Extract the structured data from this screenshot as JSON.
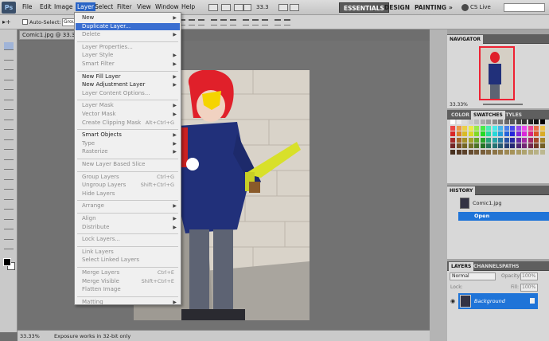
{
  "app": {
    "logo": "Ps"
  },
  "menubar": [
    "File",
    "Edit",
    "Image",
    "Layer",
    "Select",
    "Filter",
    "View",
    "Window",
    "Help"
  ],
  "active_menu": "Layer",
  "zoom_value": "33.3",
  "workspaces": [
    "ESSENTIALS",
    "DESIGN",
    "PAINTING"
  ],
  "more_symbol": "»",
  "cs_live": "CS Live",
  "options_bar": {
    "auto_select_label": "Auto-Select:",
    "auto_select_value": "Grou"
  },
  "document_tab": "Comic1.jpg @ 33.3% (R",
  "status": {
    "zoom": "33.33%",
    "message": "Exposure works in 32-bit only"
  },
  "layer_menu": [
    {
      "label": "New",
      "state": "normal",
      "arrow": true
    },
    {
      "label": "Duplicate Layer...",
      "state": "highlight"
    },
    {
      "label": "Delete",
      "state": "disabled",
      "arrow": true
    },
    {
      "sep": true
    },
    {
      "label": "Layer Properties...",
      "state": "disabled"
    },
    {
      "label": "Layer Style",
      "state": "disabled",
      "arrow": true
    },
    {
      "label": "Smart Filter",
      "state": "disabled",
      "arrow": true
    },
    {
      "sep": true
    },
    {
      "label": "New Fill Layer",
      "state": "normal",
      "arrow": true
    },
    {
      "label": "New Adjustment Layer",
      "state": "normal",
      "arrow": true
    },
    {
      "label": "Layer Content Options...",
      "state": "disabled"
    },
    {
      "sep": true
    },
    {
      "label": "Layer Mask",
      "state": "disabled",
      "arrow": true
    },
    {
      "label": "Vector Mask",
      "state": "disabled",
      "arrow": true
    },
    {
      "label": "Create Clipping Mask",
      "state": "disabled",
      "shortcut": "Alt+Ctrl+G"
    },
    {
      "sep": true
    },
    {
      "label": "Smart Objects",
      "state": "normal",
      "arrow": true
    },
    {
      "label": "Type",
      "state": "disabled",
      "arrow": true
    },
    {
      "label": "Rasterize",
      "state": "disabled",
      "arrow": true
    },
    {
      "sep": true
    },
    {
      "label": "New Layer Based Slice",
      "state": "disabled"
    },
    {
      "sep": true
    },
    {
      "label": "Group Layers",
      "state": "disabled",
      "shortcut": "Ctrl+G"
    },
    {
      "label": "Ungroup Layers",
      "state": "disabled",
      "shortcut": "Shift+Ctrl+G"
    },
    {
      "label": "Hide Layers",
      "state": "disabled"
    },
    {
      "sep": true
    },
    {
      "label": "Arrange",
      "state": "disabled",
      "arrow": true
    },
    {
      "sep": true
    },
    {
      "label": "Align",
      "state": "disabled",
      "arrow": true
    },
    {
      "label": "Distribute",
      "state": "disabled",
      "arrow": true
    },
    {
      "sep": true
    },
    {
      "label": "Lock Layers...",
      "state": "disabled"
    },
    {
      "sep": true
    },
    {
      "label": "Link Layers",
      "state": "disabled"
    },
    {
      "label": "Select Linked Layers",
      "state": "disabled"
    },
    {
      "sep": true
    },
    {
      "label": "Merge Layers",
      "state": "disabled",
      "shortcut": "Ctrl+E"
    },
    {
      "label": "Merge Visible",
      "state": "disabled",
      "shortcut": "Shift+Ctrl+E"
    },
    {
      "label": "Flatten Image",
      "state": "disabled"
    },
    {
      "sep": true
    },
    {
      "label": "Matting",
      "state": "disabled",
      "arrow": true
    }
  ],
  "navigator": {
    "title": "NAVIGATOR",
    "zoom": "33.33%"
  },
  "color_panel": {
    "tabs": [
      "COLOR",
      "SWATCHES",
      "STYLES"
    ],
    "selected": "SWATCHES"
  },
  "history": {
    "title": "HISTORY",
    "snapshot": "Comic1.jpg",
    "step": "Open"
  },
  "layers_panel": {
    "tabs": [
      "LAYERS",
      "CHANNELS",
      "PATHS"
    ],
    "blend_mode": "Normal",
    "opacity_label": "Opacity:",
    "opacity_value": "100%",
    "lock_label": "Lock:",
    "fill_label": "Fill:",
    "fill_value": "100%",
    "layer_name": "Background"
  },
  "colors": {
    "highlight": "#3a6ed0",
    "history_selected": "#1f74d8"
  }
}
